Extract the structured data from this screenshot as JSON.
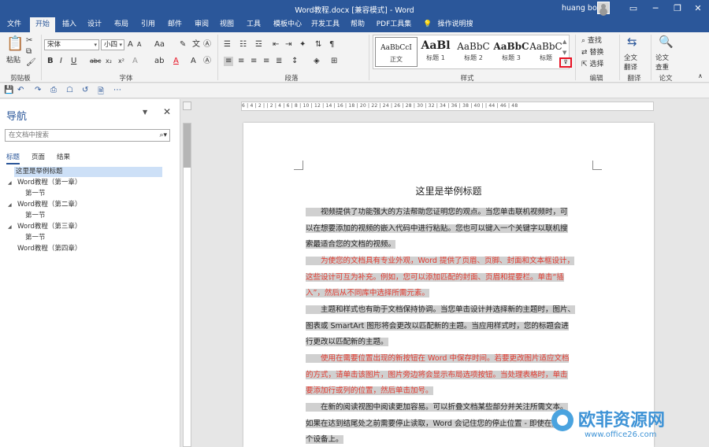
{
  "titlebar": {
    "title": "Word教程.docx [兼容模式] - Word",
    "user": "huang bo"
  },
  "tabs": [
    "文件",
    "开始",
    "插入",
    "设计",
    "布局",
    "引用",
    "邮件",
    "审阅",
    "视图",
    "工具",
    "模板中心",
    "开发工具",
    "帮助",
    "PDF工具集",
    "操作说明搜索"
  ],
  "ribbon": {
    "groups": {
      "clipboard": "剪贴板",
      "font": "字体",
      "paragraph": "段落",
      "styles": "样式",
      "editing": "编辑",
      "translate": "翻译",
      "paper": "论文"
    },
    "paste_label": "粘贴",
    "font_name": "宋体",
    "font_size": "小四",
    "styles": [
      {
        "sample": "AaBbCcI",
        "name": "正文"
      },
      {
        "sample": "AaBl",
        "name": "标题 1"
      },
      {
        "sample": "AaBbC",
        "name": "标题 2"
      },
      {
        "sample": "AaBbC",
        "name": "标题 3"
      },
      {
        "sample": "AaBbC",
        "name": "标题"
      }
    ],
    "find": "查找",
    "replace": "替换",
    "select": "选择",
    "full_translate": "全文\n翻译",
    "paper_check": "论文\n查重"
  },
  "nav": {
    "title": "导航",
    "search_placeholder": "在文档中搜索",
    "tabs": [
      "标题",
      "页面",
      "结果"
    ],
    "items": [
      {
        "label": "这里是举例标题"
      },
      {
        "label": "Word教程（第一章）"
      },
      {
        "label": "第一节"
      },
      {
        "label": "Word教程（第二章）"
      },
      {
        "label": "第一节"
      },
      {
        "label": "Word教程（第三章）"
      },
      {
        "label": "第一节"
      },
      {
        "label": "Word教程（第四章）"
      }
    ]
  },
  "ruler": "6 | 4 | 2 |   | 2 | 4 | 6 | 8 | 10 | 12 | 14 | 16 | 18 | 20 | 22 | 24 | 26 | 28 | 30 | 32 | 34 | 36 | 38 | 40 |   | 44 | 46 | 48",
  "document": {
    "title": "这里是举例标题",
    "paragraphs": [
      {
        "lines": [
          "　　视频提供了功能强大的方法帮助您证明您的观点。当您单击联机视频时，可",
          "以在想要添加的视频的嵌入代码中进行粘贴。您也可以键入一个关键字以联机搜",
          "索最适合您的文档的视频。"
        ]
      },
      {
        "lines": [
          "　　为使您的文档具有专业外观，Word 提供了页眉、页脚、封面和文本框设计，",
          "这些设计可互为补充。例如，您可以添加匹配的封面、页眉和提要栏。单击“插",
          "入”，然后从不同库中选择所需元素。"
        ]
      },
      {
        "lines": [
          "　　主题和样式也有助于文档保持协调。当您单击设计并选择新的主题时，图片、",
          "图表或 SmartArt 图形将会更改以匹配新的主题。当应用样式时，您的标题会进",
          "行更改以匹配新的主题。"
        ]
      },
      {
        "lines": [
          "　　使用在需要位置出现的新按钮在 Word 中保存时间。若要更改图片适应文档",
          "的方式，请单击该图片，图片旁边将会显示布局选项按钮。当处理表格时，单击",
          "要添加行或列的位置，然后单击加号。"
        ]
      },
      {
        "lines": [
          "　　在新的阅读视图中阅读更加容易。可以折叠文档某些部分并关注所需文本。",
          "如果在达到结尾处之前需要停止读取，Word 会记住您的停止位置 - 即使在另一",
          "个设备上。"
        ]
      }
    ]
  },
  "watermark": {
    "text": "欧菲资源网",
    "url": "www.office26.com"
  },
  "colors": {
    "accent": "#2b579a",
    "red_text": "#e23b30",
    "highlight": "#d0d0d0",
    "expand_outline": "#e81123"
  }
}
